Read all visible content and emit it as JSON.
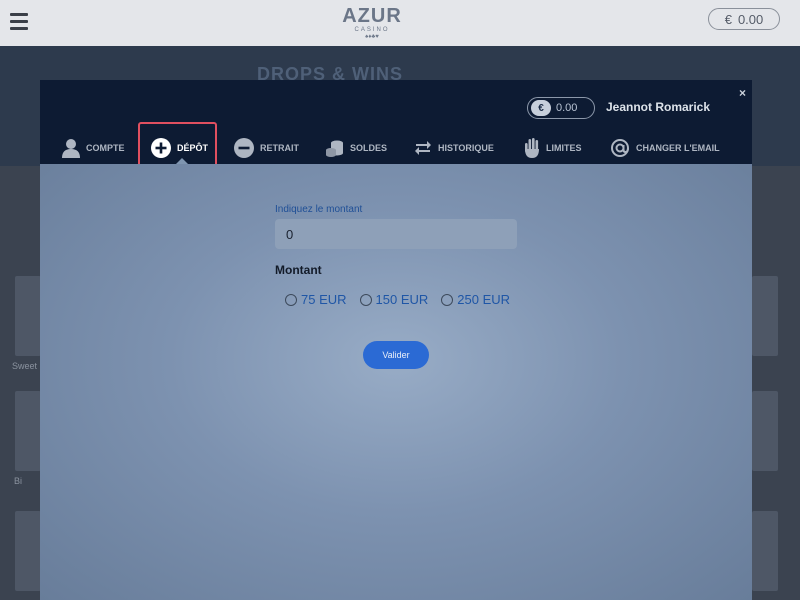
{
  "background": {
    "logo": {
      "main": "AZUR",
      "sub": "CASINO",
      "suits": "♠♦♣♥"
    },
    "balance": {
      "currency": "€",
      "amount": "0.00"
    },
    "banner_text": "DROPS & WINS",
    "thumb_labels": [
      "Sweet",
      "Bi"
    ]
  },
  "modal": {
    "close": "×",
    "wallet": {
      "currency": "€",
      "amount": "0.00"
    },
    "username": "Jeannot Romarick",
    "tabs": [
      {
        "label": "COMPTE",
        "icon": "user-icon"
      },
      {
        "label": "DÉPÔT",
        "icon": "plus-circle-icon"
      },
      {
        "label": "RETRAIT",
        "icon": "minus-circle-icon"
      },
      {
        "label": "SOLDES",
        "icon": "coins-icon"
      },
      {
        "label": "HISTORIQUE",
        "icon": "swap-arrows-icon"
      },
      {
        "label": "LIMITES",
        "icon": "hand-icon"
      },
      {
        "label": "CHANGER L'EMAIL",
        "icon": "at-sign-icon"
      }
    ],
    "active_tab": "DÉPÔT",
    "form": {
      "amount_label": "Indiquez le montant",
      "amount_value": "0",
      "montant_title": "Montant",
      "options": [
        "75 EUR",
        "150 EUR",
        "250 EUR"
      ],
      "submit_label": "Valider"
    }
  },
  "colors": {
    "accent": "#2b6ad4",
    "header": "#0d1b33",
    "highlight": "#e05060"
  }
}
